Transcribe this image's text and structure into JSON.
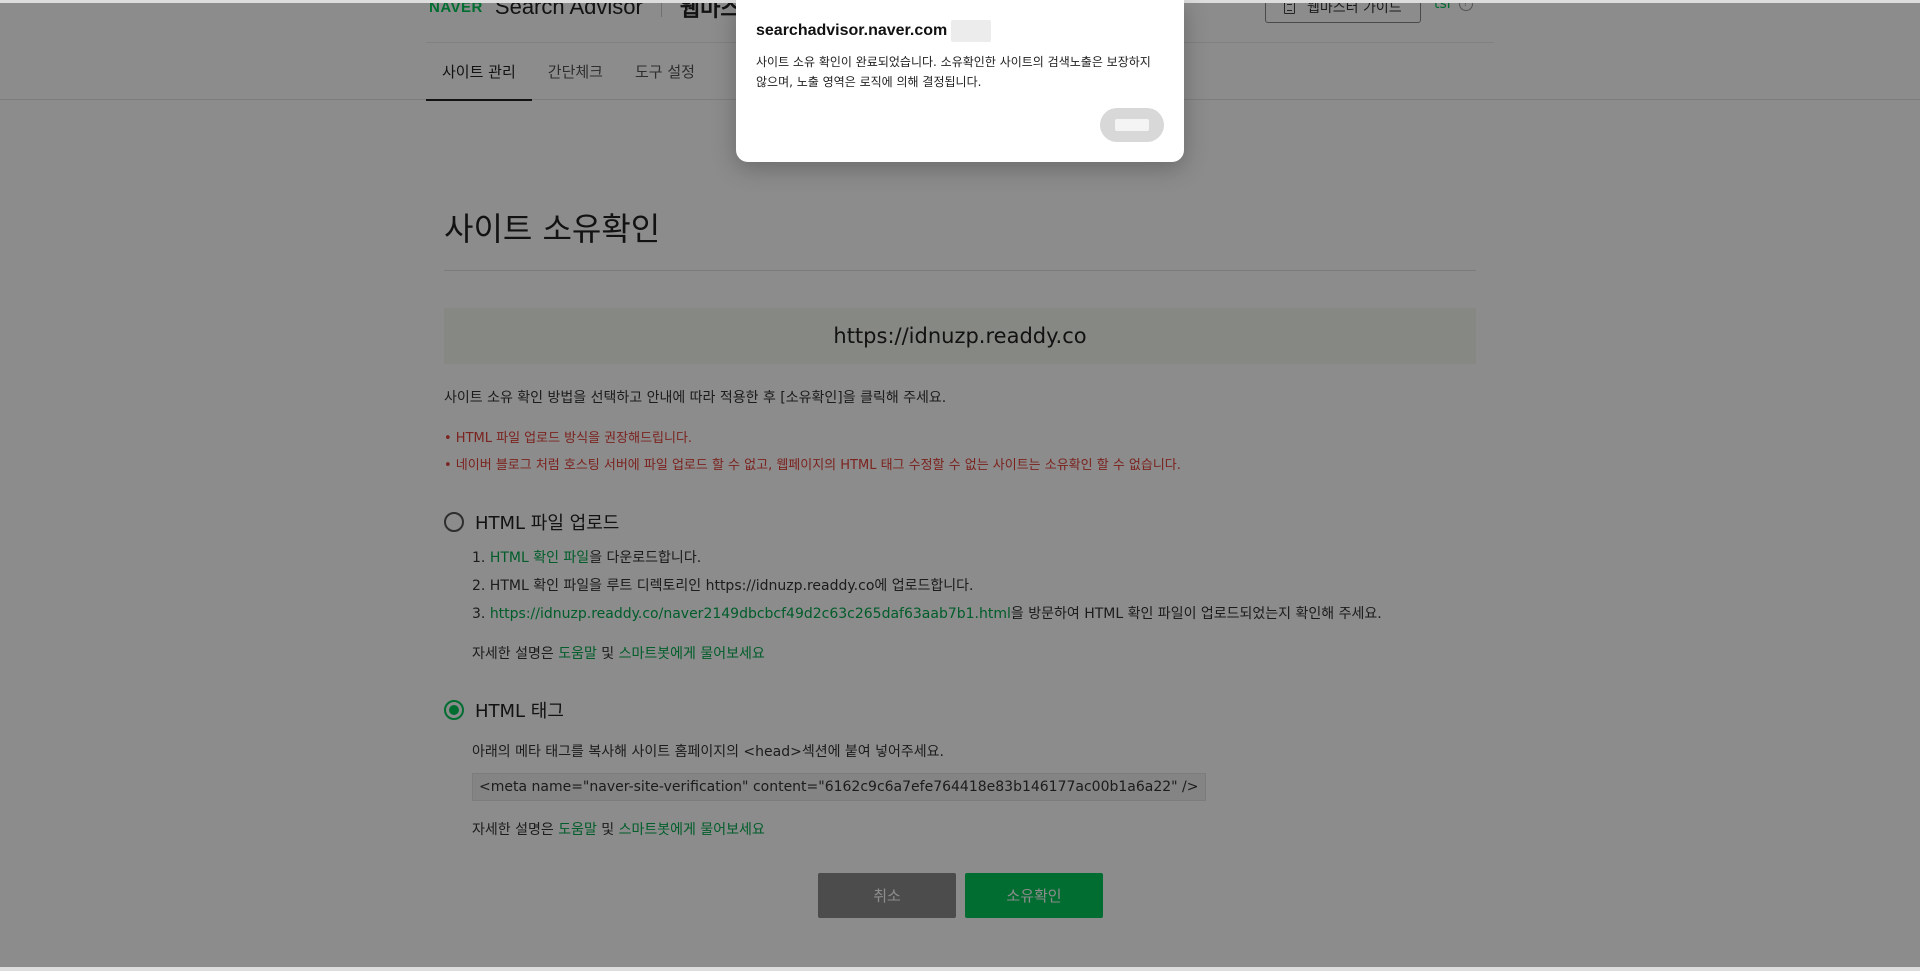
{
  "header": {
    "logo": "NAVER",
    "brand": "Search Advisor",
    "sub_brand": "웹마스터",
    "guide_button": "웹마스터 가이드",
    "user": "tsr",
    "info_glyph": "?",
    "doc_icon": "document-icon"
  },
  "tabs": [
    {
      "label": "사이트 관리",
      "active": true
    },
    {
      "label": "간단체크",
      "active": false
    },
    {
      "label": "도구 설정",
      "active": false
    }
  ],
  "main": {
    "title": "사이트 소유확인",
    "site_url": "https://idnuzp.readdy.co",
    "intro": "사이트 소유 확인 방법을 선택하고 안내에 따라 적용한 후 [소유확인]을 클릭해 주세요.",
    "note1": "• HTML 파일 업로드 방식을 권장해드립니다.",
    "note2": "• 네이버 블로그 처럼 호스팅 서버에 파일 업로드 할 수 없고, 웹페이지의 HTML 태그 수정할 수 없는 사이트는 소유확인 할 수 없습니다."
  },
  "html_file": {
    "label": "HTML 파일 업로드",
    "step1_num": "1. ",
    "step1_link": "HTML 확인 파일",
    "step1_rest": "을 다운로드합니다.",
    "step2": "2. HTML 확인 파일을 루트 디렉토리인 https://idnuzp.readdy.co에 업로드합니다.",
    "step3_num": "3. ",
    "step3_link": "https://idnuzp.readdy.co/naver2149dbcbcf49d2c63c265daf63aab7b1.html",
    "step3_rest": "을 방문하여 HTML 확인 파일이 업로드되었는지 확인해 주세요.",
    "help_prefix": "자세한 설명은 ",
    "help_link1": "도움말",
    "help_mid": " 및 ",
    "help_link2": "스마트봇에게 물어보세요"
  },
  "html_tag": {
    "label": "HTML 태그",
    "desc": "아래의 메타 태그를 복사해 사이트 홈페이지의 <head>섹션에 붙여 넣어주세요.",
    "meta": "<meta name=\"naver-site-verification\" content=\"6162c9c6a7efe764418e83b146177ac00b1a6a22\" />",
    "help_prefix": "자세한 설명은 ",
    "help_link1": "도움말",
    "help_mid": " 및 ",
    "help_link2": "스마트봇에게 물어보세요"
  },
  "buttons": {
    "cancel": "취소",
    "confirm": "소유확인"
  },
  "dialog": {
    "host": "searchadvisor.naver.com",
    "message": "사이트 소유 확인이 완료되었습니다. 소유확인한 사이트의 검색노출은 보장하지 않으며, 노출 영역은 로직에 의해 결정됩니다."
  },
  "colors": {
    "accent": "#03c75a",
    "warning": "#e0403a",
    "url_box_bg": "#f4f9ef"
  }
}
